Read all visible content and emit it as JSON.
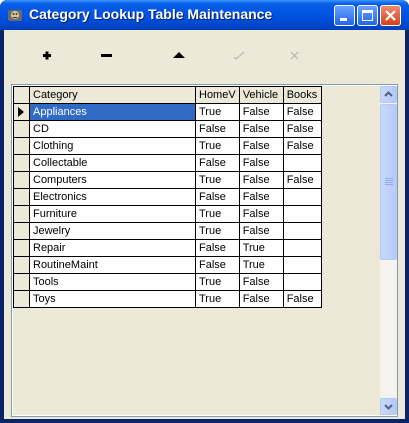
{
  "window": {
    "title": "Category Lookup Table Maintenance",
    "icons": {
      "app": "app-icon",
      "minimize": "minimize-icon",
      "maximize": "maximize-icon",
      "close": "close-icon"
    }
  },
  "toolbar": {
    "buttons": [
      {
        "name": "add",
        "icon": "plus-icon",
        "enabled": true
      },
      {
        "name": "delete",
        "icon": "minus-icon",
        "enabled": true
      },
      {
        "name": "edit",
        "icon": "triangle-up-icon",
        "enabled": true
      },
      {
        "name": "post",
        "icon": "checkmark-icon",
        "enabled": false
      },
      {
        "name": "cancel",
        "icon": "cancel-x-icon",
        "enabled": false
      }
    ]
  },
  "grid": {
    "columns": [
      "Category",
      "HomeV",
      "Vehicle",
      "Books"
    ],
    "rows": [
      [
        "Appliances",
        "True",
        "False",
        "False"
      ],
      [
        "CD",
        "False",
        "False",
        "False"
      ],
      [
        "Clothing",
        "True",
        "False",
        "False"
      ],
      [
        "Collectable",
        "False",
        "False",
        ""
      ],
      [
        "Computers",
        "True",
        "False",
        "False"
      ],
      [
        "Electronics",
        "False",
        "False",
        ""
      ],
      [
        "Furniture",
        "True",
        "False",
        ""
      ],
      [
        "Jewelry",
        "True",
        "False",
        ""
      ],
      [
        "Repair",
        "False",
        "True",
        ""
      ],
      [
        "RoutineMaint",
        "False",
        "True",
        ""
      ],
      [
        "Tools",
        "True",
        "False",
        ""
      ],
      [
        "Toys",
        "True",
        "False",
        "False"
      ]
    ],
    "selected_row": 0
  },
  "colors": {
    "titlebar": "#0054e3",
    "selection": "#316ac5",
    "face": "#ece9d8"
  }
}
